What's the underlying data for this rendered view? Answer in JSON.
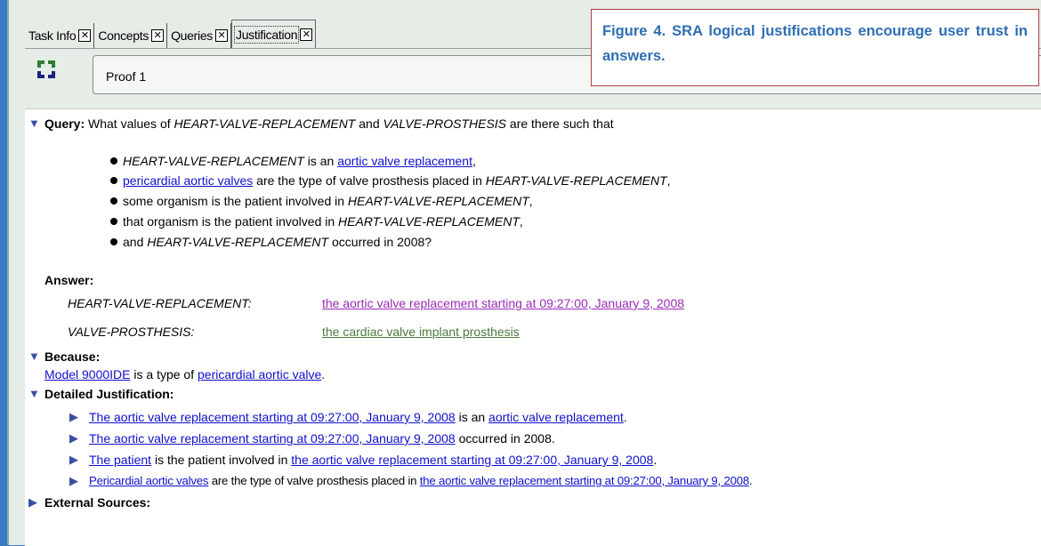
{
  "tabs": [
    {
      "label": "Task Info"
    },
    {
      "label": "Concepts"
    },
    {
      "label": "Queries"
    },
    {
      "label": "Justification"
    }
  ],
  "proof": {
    "value": "Proof 1"
  },
  "caption": {
    "text": "Figure 4.  SRA  logical  justifications encourage user trust in answers."
  },
  "query": {
    "heading": "Query:",
    "intro": "What values of ",
    "var1": "HEART-VALVE-REPLACEMENT",
    "and": " and ",
    "var2": "VALVE-PROSTHESIS",
    "tail": " are there such that",
    "b1_var": "HEART-VALVE-REPLACEMENT",
    "b1_mid": " is an ",
    "b1_link": "aortic valve replacement",
    "b1_end": ",",
    "b2_link": "pericardial aortic valves",
    "b2_mid": " are the type of valve prosthesis placed in ",
    "b2_var": "HEART-VALVE-REPLACEMENT",
    "b2_end": ",",
    "b3_text": "some organism is the patient involved in ",
    "b3_var": "HEART-VALVE-REPLACEMENT",
    "b3_end": ",",
    "b4_text": "that organism is the patient involved in ",
    "b4_var": "HEART-VALVE-REPLACEMENT",
    "b4_end": ",",
    "b5_text": "and ",
    "b5_var": "HEART-VALVE-REPLACEMENT",
    "b5_end": " occurred in 2008?"
  },
  "answer": {
    "heading": "Answer:",
    "row1_var": "HEART-VALVE-REPLACEMENT:",
    "row1_value": "the aortic valve replacement starting at 09:27:00, January 9, 2008",
    "row2_var": "VALVE-PROSTHESIS:",
    "row2_value": "the cardiac valve implant prosthesis"
  },
  "because": {
    "heading": "Because:",
    "link1": "Model 9000IDE",
    "mid": " is a type of ",
    "link2": "pericardial aortic valve",
    "end": "."
  },
  "detailed": {
    "heading": "Detailed Justification:",
    "l1_link1": "The aortic valve replacement starting at 09:27:00, January 9, 2008",
    "l1_mid": " is an ",
    "l1_link2": "aortic valve replacement",
    "l1_end": ".",
    "l2_link1": "The aortic valve replacement starting at 09:27:00, January 9, 2008",
    "l2_end": " occurred in 2008.",
    "l3_link1": "The patient",
    "l3_mid": " is the patient involved in ",
    "l3_link2": "the aortic valve replacement starting at 09:27:00, January 9, 2008",
    "l3_end": ".",
    "l4_link1": "Pericardial aortic valves",
    "l4_mid": " are the type of valve prosthesis placed in ",
    "l4_link2": "the aortic valve replacement starting at 09:27:00, January 9, 2008",
    "l4_end": "."
  },
  "external": {
    "heading": "External Sources:"
  },
  "colors": {
    "link": "#1010cc",
    "visited_purple": "#9a2ab8",
    "green_link": "#4a7a3a",
    "caption_text": "#2e6eb3",
    "caption_border": "#b04040"
  }
}
